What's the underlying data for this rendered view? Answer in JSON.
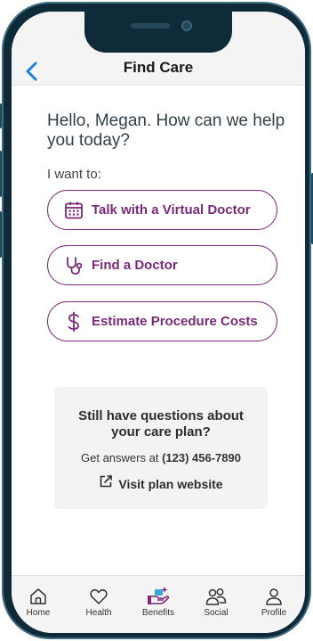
{
  "navbar": {
    "title": "Find Care",
    "back_icon": "chevron-left-icon"
  },
  "greeting": "Hello, Megan. How can we help you today?",
  "intro": "I want to:",
  "actions": [
    {
      "label": "Talk with a Virtual Doctor",
      "icon": "calendar-icon"
    },
    {
      "label": "Find a Doctor",
      "icon": "stethoscope-icon"
    },
    {
      "label": "Estimate Procedure Costs",
      "icon": "dollar-icon"
    }
  ],
  "help_card": {
    "title": "Still have questions about your care plan?",
    "answers_prefix": "Get answers at ",
    "phone": "(123) 456-7890",
    "link_label": "Visit plan website",
    "link_icon": "external-link-icon"
  },
  "tabs": [
    {
      "label": "Home",
      "icon": "home-icon"
    },
    {
      "label": "Health",
      "icon": "heart-icon"
    },
    {
      "label": "Benefits",
      "icon": "benefits-hand-icon"
    },
    {
      "label": "Social",
      "icon": "people-icon"
    },
    {
      "label": "Profile",
      "icon": "person-icon"
    }
  ],
  "colors": {
    "accent": "#7a2a78",
    "ios_blue": "#1a7fe0",
    "frame": "#0f2b3a"
  }
}
